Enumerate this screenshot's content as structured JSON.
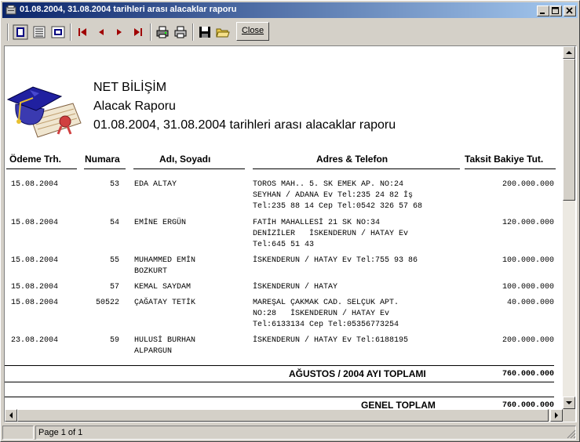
{
  "window": {
    "title": "01.08.2004, 31.08.2004 tarihleri arası alacaklar raporu"
  },
  "toolbar": {
    "tools": [
      "whole-page-icon",
      "page-width-icon",
      "zoom-icon",
      "first-page-icon",
      "prev-page-icon",
      "next-page-icon",
      "last-page-icon",
      "print-setup-icon",
      "print-icon",
      "save-icon",
      "open-icon"
    ],
    "close_label": "Close"
  },
  "report": {
    "company": "NET BİLİŞİM",
    "title": "Alacak Raporu",
    "subtitle": "01.08.2004, 31.08.2004 tarihleri arası alacaklar raporu",
    "columns": {
      "date": "Ödeme Trh.",
      "number": "Numara",
      "name": "Adı, Soyadı",
      "address": "Adres & Telefon",
      "balance": "Taksit Bakiye Tut."
    },
    "rows": [
      {
        "date": "15.08.2004",
        "number": "53",
        "name": "EDA ALTAY",
        "address": "TOROS MAH.. 5. SK EMEK AP. NO:24\nSEYHAN / ADANA Ev Tel:235 24 82 İş\nTel:235 88 14 Cep Tel:0542 326 57 68",
        "balance": "200.000.000"
      },
      {
        "date": "15.08.2004",
        "number": "54",
        "name": "EMİNE ERGÜN",
        "address": "FATİH MAHALLESİ 21 SK NO:34\nDENİZİLER   İSKENDERUN / HATAY Ev\nTel:645 51 43",
        "balance": "120.000.000"
      },
      {
        "date": "15.08.2004",
        "number": "55",
        "name": "MUHAMMED EMİN\nBOZKURT",
        "address": "İSKENDERUN / HATAY Ev Tel:755 93 86",
        "balance": "100.000.000"
      },
      {
        "date": "15.08.2004",
        "number": "57",
        "name": "KEMAL SAYDAM",
        "address": "İSKENDERUN / HATAY",
        "balance": "100.000.000"
      },
      {
        "date": "15.08.2004",
        "number": "50522",
        "name": "ÇAĞATAY TETİK",
        "address": "MAREŞAL ÇAKMAK CAD. SELÇUK APT.\nNO:28   İSKENDERUN / HATAY Ev\nTel:6133134 Cep Tel:05356773254",
        "balance": "40.000.000"
      },
      {
        "date": "23.08.2004",
        "number": "59",
        "name": "HULUSİ BURHAN\nALPARGUN",
        "address": "İSKENDERUN / HATAY Ev Tel:6188195",
        "balance": "200.000.000"
      }
    ],
    "month_total_label": "AĞUSTOS / 2004 AYI TOPLAMI",
    "month_total_value": "760.000.000",
    "grand_total_label": "GENEL TOPLAM",
    "grand_total_value": "760.000.000"
  },
  "status": {
    "page": "Page 1 of 1"
  }
}
